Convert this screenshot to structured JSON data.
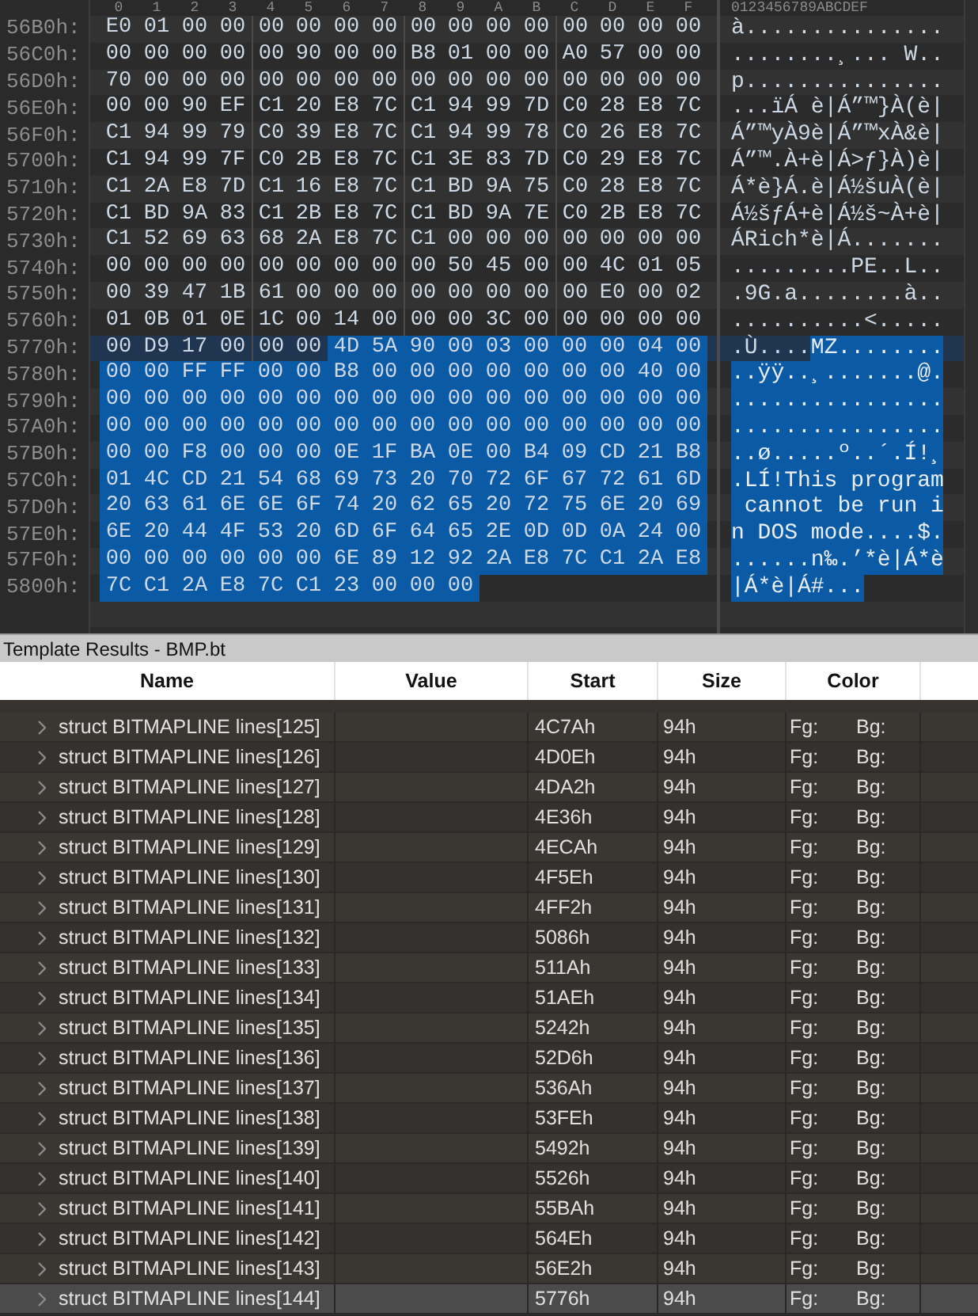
{
  "hex_view": {
    "column_header": [
      "0",
      "1",
      "2",
      "3",
      "4",
      "5",
      "6",
      "7",
      "8",
      "9",
      "A",
      "B",
      "C",
      "D",
      "E",
      "F"
    ],
    "ascii_header": "0123456789ABCDEF",
    "rows": [
      {
        "address": "56B0h:",
        "cursor": false,
        "bytes": "E0 01 00 00 00 00 00 00 00 00 00 00 00 00 00 00",
        "text": "à..............."
      },
      {
        "address": "56C0h:",
        "cursor": false,
        "bytes": "00 00 00 00 00 90 00 00 B8 01 00 00 A0 57 00 00",
        "text": "........¸... W.."
      },
      {
        "address": "56D0h:",
        "cursor": false,
        "bytes": "70 00 00 00 00 00 00 00 00 00 00 00 00 00 00 00",
        "text": "p..............."
      },
      {
        "address": "56E0h:",
        "cursor": false,
        "bytes": "00 00 90 EF C1 20 E8 7C C1 94 99 7D C0 28 E8 7C",
        "text": "...ïÁ è|Á”™}À(è|"
      },
      {
        "address": "56F0h:",
        "cursor": false,
        "bytes": "C1 94 99 79 C0 39 E8 7C C1 94 99 78 C0 26 E8 7C",
        "text": "Á”™yÀ9è|Á”™xÀ&è|"
      },
      {
        "address": "5700h:",
        "cursor": false,
        "bytes": "C1 94 99 7F C0 2B E8 7C C1 3E 83 7D C0 29 E8 7C",
        "text": "Á”™.À+è|Á>ƒ}À)è|"
      },
      {
        "address": "5710h:",
        "cursor": false,
        "bytes": "C1 2A E8 7D C1 16 E8 7C C1 BD 9A 75 C0 28 E8 7C",
        "text": "Á*è}Á.è|Á½šuÀ(è|"
      },
      {
        "address": "5720h:",
        "cursor": false,
        "bytes": "C1 BD 9A 83 C1 2B E8 7C C1 BD 9A 7E C0 2B E8 7C",
        "text": "Á½šƒÁ+è|Á½š~À+è|"
      },
      {
        "address": "5730h:",
        "cursor": false,
        "bytes": "C1 52 69 63 68 2A E8 7C C1 00 00 00 00 00 00 00",
        "text": "ÁRich*è|Á......."
      },
      {
        "address": "5740h:",
        "cursor": false,
        "bytes": "00 00 00 00 00 00 00 00 00 50 45 00 00 4C 01 05",
        "text": ".........PE..L.."
      },
      {
        "address": "5750h:",
        "cursor": false,
        "bytes": "00 39 47 1B 61 00 00 00 00 00 00 00 00 E0 00 02",
        "text": ".9G.a........à.."
      },
      {
        "address": "5760h:",
        "cursor": false,
        "bytes": "01 0B 01 0E 1C 00 14 00 00 00 3C 00 00 00 00 00",
        "text": "..........<....."
      },
      {
        "address": "5770h:",
        "cursor": true,
        "bytes": "00 D9 17 00 00 00",
        "text": ".Ù....",
        "selected_bytes": "4D 5A 90 00 03 00 00 00 04 00",
        "selected_text": "MZ........"
      },
      {
        "address": "5780h:",
        "cursor": false,
        "selected_bytes": "00 00 FF FF 00 00 B8 00 00 00 00 00 00 00 40 00",
        "selected_text": "..ÿÿ..¸.......@."
      },
      {
        "address": "5790h:",
        "cursor": false,
        "selected_bytes": "00 00 00 00 00 00 00 00 00 00 00 00 00 00 00 00",
        "selected_text": "................"
      },
      {
        "address": "57A0h:",
        "cursor": false,
        "selected_bytes": "00 00 00 00 00 00 00 00 00 00 00 00 00 00 00 00",
        "selected_text": "................"
      },
      {
        "address": "57B0h:",
        "cursor": false,
        "selected_bytes": "00 00 F8 00 00 00 0E 1F BA 0E 00 B4 09 CD 21 B8",
        "selected_text": "..ø.....º..´.Í!¸"
      },
      {
        "address": "57C0h:",
        "cursor": false,
        "selected_bytes": "01 4C CD 21 54 68 69 73 20 70 72 6F 67 72 61 6D",
        "selected_text": ".LÍ!This program"
      },
      {
        "address": "57D0h:",
        "cursor": false,
        "selected_bytes": "20 63 61 6E 6E 6F 74 20 62 65 20 72 75 6E 20 69",
        "selected_text": " cannot be run i"
      },
      {
        "address": "57E0h:",
        "cursor": false,
        "selected_bytes": "6E 20 44 4F 53 20 6D 6F 64 65 2E 0D 0D 0A 24 00",
        "selected_text": "n DOS mode....$."
      },
      {
        "address": "57F0h:",
        "cursor": false,
        "selected_bytes": "00 00 00 00 00 00 6E 89 12 92 2A E8 7C C1 2A E8",
        "selected_text": "......n‰.’*è|Á*è"
      },
      {
        "address": "5800h:",
        "cursor": false,
        "selected_bytes": "7C C1 2A E8 7C C1 23 00 00 00",
        "selected_text": "|Á*è|Á#..."
      }
    ]
  },
  "template_results": {
    "title": "Template Results - BMP.bt",
    "columns": [
      "Name",
      "Value",
      "Start",
      "Size",
      "Color"
    ],
    "rows": [
      {
        "name": "struct BITMAPLINE lines[125]",
        "start": "4C7Ah",
        "size": "94h",
        "fg": "Fg:",
        "bg": "Bg:",
        "selected": false
      },
      {
        "name": "struct BITMAPLINE lines[126]",
        "start": "4D0Eh",
        "size": "94h",
        "fg": "Fg:",
        "bg": "Bg:",
        "selected": false
      },
      {
        "name": "struct BITMAPLINE lines[127]",
        "start": "4DA2h",
        "size": "94h",
        "fg": "Fg:",
        "bg": "Bg:",
        "selected": false
      },
      {
        "name": "struct BITMAPLINE lines[128]",
        "start": "4E36h",
        "size": "94h",
        "fg": "Fg:",
        "bg": "Bg:",
        "selected": false
      },
      {
        "name": "struct BITMAPLINE lines[129]",
        "start": "4ECAh",
        "size": "94h",
        "fg": "Fg:",
        "bg": "Bg:",
        "selected": false
      },
      {
        "name": "struct BITMAPLINE lines[130]",
        "start": "4F5Eh",
        "size": "94h",
        "fg": "Fg:",
        "bg": "Bg:",
        "selected": false
      },
      {
        "name": "struct BITMAPLINE lines[131]",
        "start": "4FF2h",
        "size": "94h",
        "fg": "Fg:",
        "bg": "Bg:",
        "selected": false
      },
      {
        "name": "struct BITMAPLINE lines[132]",
        "start": "5086h",
        "size": "94h",
        "fg": "Fg:",
        "bg": "Bg:",
        "selected": false
      },
      {
        "name": "struct BITMAPLINE lines[133]",
        "start": "511Ah",
        "size": "94h",
        "fg": "Fg:",
        "bg": "Bg:",
        "selected": false
      },
      {
        "name": "struct BITMAPLINE lines[134]",
        "start": "51AEh",
        "size": "94h",
        "fg": "Fg:",
        "bg": "Bg:",
        "selected": false
      },
      {
        "name": "struct BITMAPLINE lines[135]",
        "start": "5242h",
        "size": "94h",
        "fg": "Fg:",
        "bg": "Bg:",
        "selected": false
      },
      {
        "name": "struct BITMAPLINE lines[136]",
        "start": "52D6h",
        "size": "94h",
        "fg": "Fg:",
        "bg": "Bg:",
        "selected": false
      },
      {
        "name": "struct BITMAPLINE lines[137]",
        "start": "536Ah",
        "size": "94h",
        "fg": "Fg:",
        "bg": "Bg:",
        "selected": false
      },
      {
        "name": "struct BITMAPLINE lines[138]",
        "start": "53FEh",
        "size": "94h",
        "fg": "Fg:",
        "bg": "Bg:",
        "selected": false
      },
      {
        "name": "struct BITMAPLINE lines[139]",
        "start": "5492h",
        "size": "94h",
        "fg": "Fg:",
        "bg": "Bg:",
        "selected": false
      },
      {
        "name": "struct BITMAPLINE lines[140]",
        "start": "5526h",
        "size": "94h",
        "fg": "Fg:",
        "bg": "Bg:",
        "selected": false
      },
      {
        "name": "struct BITMAPLINE lines[141]",
        "start": "55BAh",
        "size": "94h",
        "fg": "Fg:",
        "bg": "Bg:",
        "selected": false
      },
      {
        "name": "struct BITMAPLINE lines[142]",
        "start": "564Eh",
        "size": "94h",
        "fg": "Fg:",
        "bg": "Bg:",
        "selected": false
      },
      {
        "name": "struct BITMAPLINE lines[143]",
        "start": "56E2h",
        "size": "94h",
        "fg": "Fg:",
        "bg": "Bg:",
        "selected": false
      },
      {
        "name": "struct BITMAPLINE lines[144]",
        "start": "5776h",
        "size": "94h",
        "fg": "Fg:",
        "bg": "Bg:",
        "selected": true
      }
    ]
  }
}
